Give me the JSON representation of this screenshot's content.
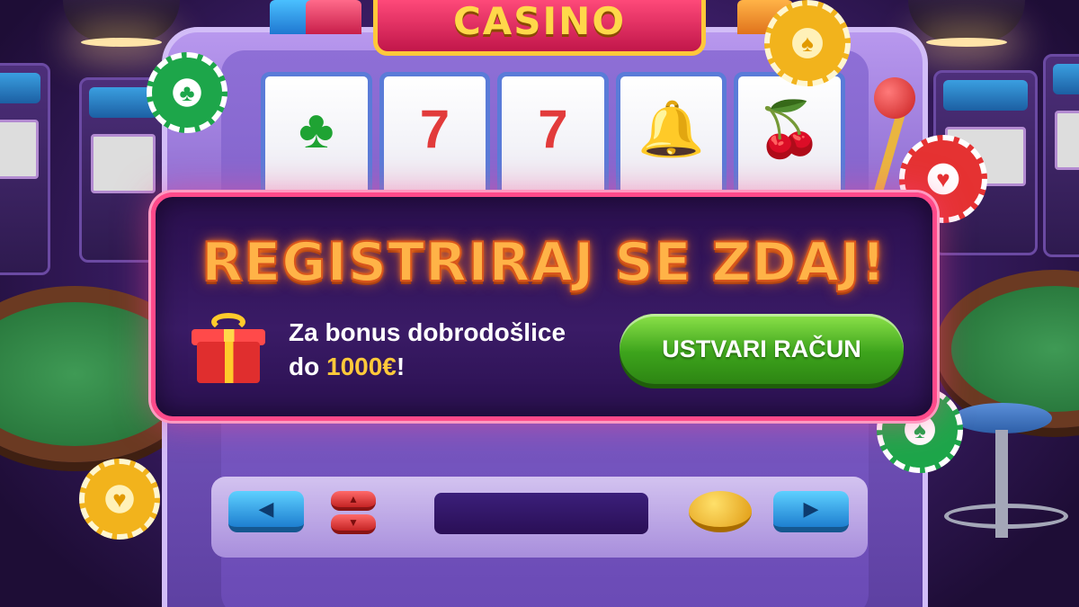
{
  "header": {
    "logo_text": "CASINO"
  },
  "banner": {
    "headline": "REGISTRIRAJ SE ZDAJ!",
    "bonus_line1": "Za bonus dobrodošlice",
    "bonus_prefix": "do ",
    "bonus_amount": "1000€",
    "bonus_suffix": "!",
    "cta_label": "USTVARI RAČUN"
  },
  "reels": [
    {
      "icon": "tree-icon",
      "glyph": "♣"
    },
    {
      "icon": "seven-icon",
      "glyph": "7"
    },
    {
      "icon": "seven-icon",
      "glyph": "7"
    },
    {
      "icon": "bell-icon",
      "glyph": "🔔"
    },
    {
      "icon": "cherry-icon",
      "glyph": "🍒"
    }
  ],
  "colors": {
    "banner_border": "#ff4a8a",
    "headline": "#ffb347",
    "cta_green": "#3da41c",
    "bonus_amount": "#ffc93a",
    "logo_bg": "#c1164a",
    "logo_text": "#ffd84a"
  }
}
